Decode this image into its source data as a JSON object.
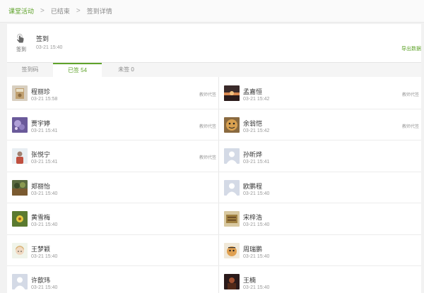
{
  "breadcrumb": {
    "items": [
      "课堂活动",
      "已结束",
      "签到详情"
    ]
  },
  "activity": {
    "icon_label": "签到",
    "title": "签到",
    "time": "03-21 15:40",
    "export_label": "导出数据"
  },
  "tabs": [
    {
      "label": "签到码"
    },
    {
      "label": "已签 54"
    },
    {
      "label": "未签 0"
    }
  ],
  "students": [
    {
      "name": "程丽珍",
      "time": "03-21 15:58",
      "note": "教师代签",
      "avatar": "photo-book"
    },
    {
      "name": "孟嘉恒",
      "time": "03-21 15:42",
      "note": "教师代签",
      "avatar": "photo-sunset"
    },
    {
      "name": "贾宇婷",
      "time": "03-21 15:41",
      "note": "教师代签",
      "avatar": "photo-galaxy"
    },
    {
      "name": "余翁恺",
      "time": "03-21 15:42",
      "note": "教师代签",
      "avatar": "photo-tiger"
    },
    {
      "name": "张悦宁",
      "time": "03-21 15:41",
      "note": "教师代签",
      "avatar": "photo-person"
    },
    {
      "name": "孙昕烨",
      "time": "03-21 15:41",
      "note": "",
      "avatar": "default-user"
    },
    {
      "name": "郑丽怡",
      "time": "03-21 15:40",
      "note": "",
      "avatar": "photo-forest"
    },
    {
      "name": "欧鹏程",
      "time": "03-21 15:40",
      "note": "",
      "avatar": "default-user"
    },
    {
      "name": "黄雪梅",
      "time": "03-21 15:40",
      "note": "",
      "avatar": "photo-flower"
    },
    {
      "name": "宋梓浩",
      "time": "03-21 15:40",
      "note": "",
      "avatar": "photo-sign"
    },
    {
      "name": "王梦颖",
      "time": "03-21 15:40",
      "note": "",
      "avatar": "photo-cartoon-girl"
    },
    {
      "name": "周瑞鹏",
      "time": "03-21 15:40",
      "note": "",
      "avatar": "photo-tiger-cub"
    },
    {
      "name": "许歆玮",
      "time": "03-21 15:40",
      "note": "",
      "avatar": "default-user"
    },
    {
      "name": "王楠",
      "time": "03-21 15:40",
      "note": "",
      "avatar": "photo-dark"
    }
  ]
}
